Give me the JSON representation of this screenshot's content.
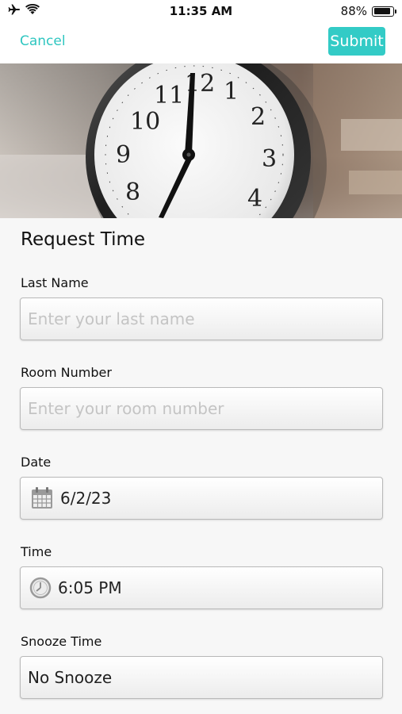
{
  "status_bar": {
    "time": "11:35 AM",
    "battery_text": "88%",
    "battery_level": 0.88,
    "icons": [
      "airplane-icon",
      "wifi-icon",
      "battery-icon"
    ]
  },
  "nav": {
    "cancel_label": "Cancel",
    "submit_label": "Submit"
  },
  "colors": {
    "accent": "#2ec6c0",
    "submit_bg": "#33cbc6"
  },
  "hero": {
    "image": "alarm-clock-photo",
    "numerals": [
      "12",
      "1",
      "2",
      "3",
      "4",
      "8",
      "9",
      "10",
      "11"
    ]
  },
  "form": {
    "title": "Request Time",
    "last_name": {
      "label": "Last Name",
      "placeholder": "Enter your last name",
      "value": ""
    },
    "room_number": {
      "label": "Room Number",
      "placeholder": "Enter your room number",
      "value": ""
    },
    "date": {
      "label": "Date",
      "value": "6/2/23",
      "icon": "calendar-icon"
    },
    "time": {
      "label": "Time",
      "value": "6:05 PM",
      "icon": "clock-icon"
    },
    "snooze": {
      "label": "Snooze Time",
      "value": "No Snooze"
    }
  }
}
